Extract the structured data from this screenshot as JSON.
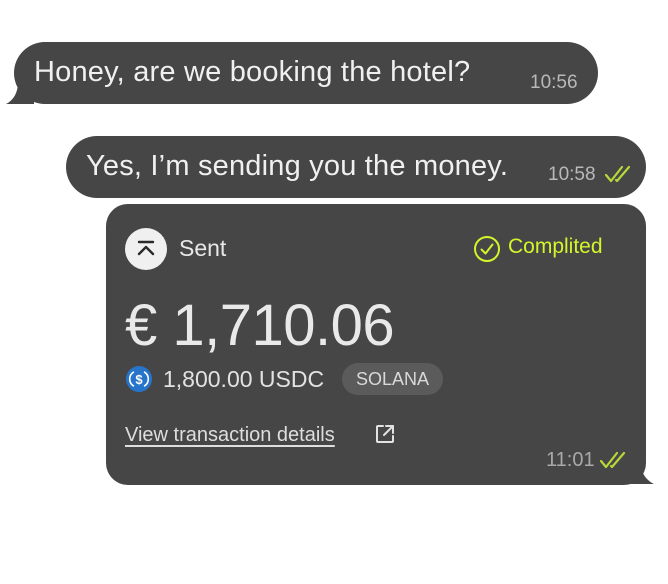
{
  "messages": [
    {
      "direction": "incoming",
      "text": "Honey, are we booking the hotel?",
      "time": "10:56"
    },
    {
      "direction": "outgoing",
      "text": "Yes, I’m sending you the money.",
      "time": "10:58",
      "status_icon": "double-check-icon"
    }
  ],
  "payment_card": {
    "direction_icon": "sent-arrow-icon",
    "direction_label": "Sent",
    "status_icon": "check-circle-icon",
    "status_label": "Complited",
    "amount": "€ 1,710.06",
    "token_icon": "usdc-coin-icon",
    "crypto_amount": "1,800.00 USDC",
    "network": "SOLANA",
    "details_link": "View transaction details",
    "details_link_icon": "external-link-icon",
    "time": "11:01",
    "read_status_icon": "double-check-icon"
  },
  "colors": {
    "bubble": "#464646",
    "text": "#f0f0f0",
    "accent": "#d4f52a",
    "badge": "#5b5b5b",
    "usdc_blue": "#2775ca"
  }
}
